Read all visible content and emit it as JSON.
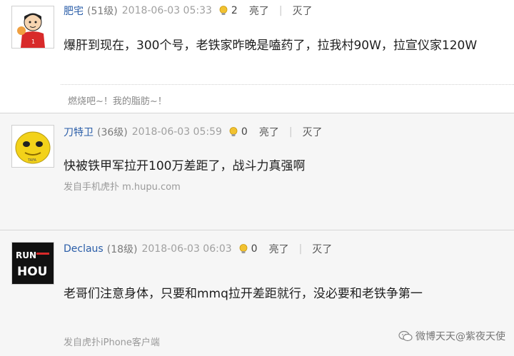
{
  "posts": [
    {
      "username": "肥宅",
      "level": "(51级)",
      "time": "2018-06-03 05:33",
      "light_count": "2",
      "light_label": "亮了",
      "separator": "|",
      "dark_label": "灭了",
      "content": "爆肝到现在，300个号，老铁家昨晚是嗑药了，拉我村90W，拉宣仪家120W",
      "reply": "燃烧吧~！我的脂肪~！"
    },
    {
      "username": "刀特卫",
      "level": "(36级)",
      "time": "2018-06-03 05:59",
      "light_count": "0",
      "light_label": "亮了",
      "separator": "|",
      "dark_label": "灭了",
      "content": "快被铁甲军拉开100万差距了，战斗力真强啊",
      "source": "发自手机虎扑 m.hupu.com"
    },
    {
      "username": "Declaus",
      "level": "(18级)",
      "time": "2018-06-03 06:03",
      "light_count": "0",
      "light_label": "亮了",
      "separator": "|",
      "dark_label": "灭了",
      "content": "老哥们注意身体，只要和mmq拉开差距就行，没必要和老铁争第一",
      "source": "发自虎扑iPhone客户端",
      "avatar_text_top": "RUN",
      "avatar_text_bottom": "HOU"
    }
  ],
  "watermark": {
    "text": "微博天天@紫夜天使"
  },
  "colors": {
    "username": "#2a5da8",
    "bulb": "#f2c230",
    "divider": "#d6d6d6"
  },
  "icons": [
    "lightbulb-icon",
    "wechat-icon"
  ]
}
